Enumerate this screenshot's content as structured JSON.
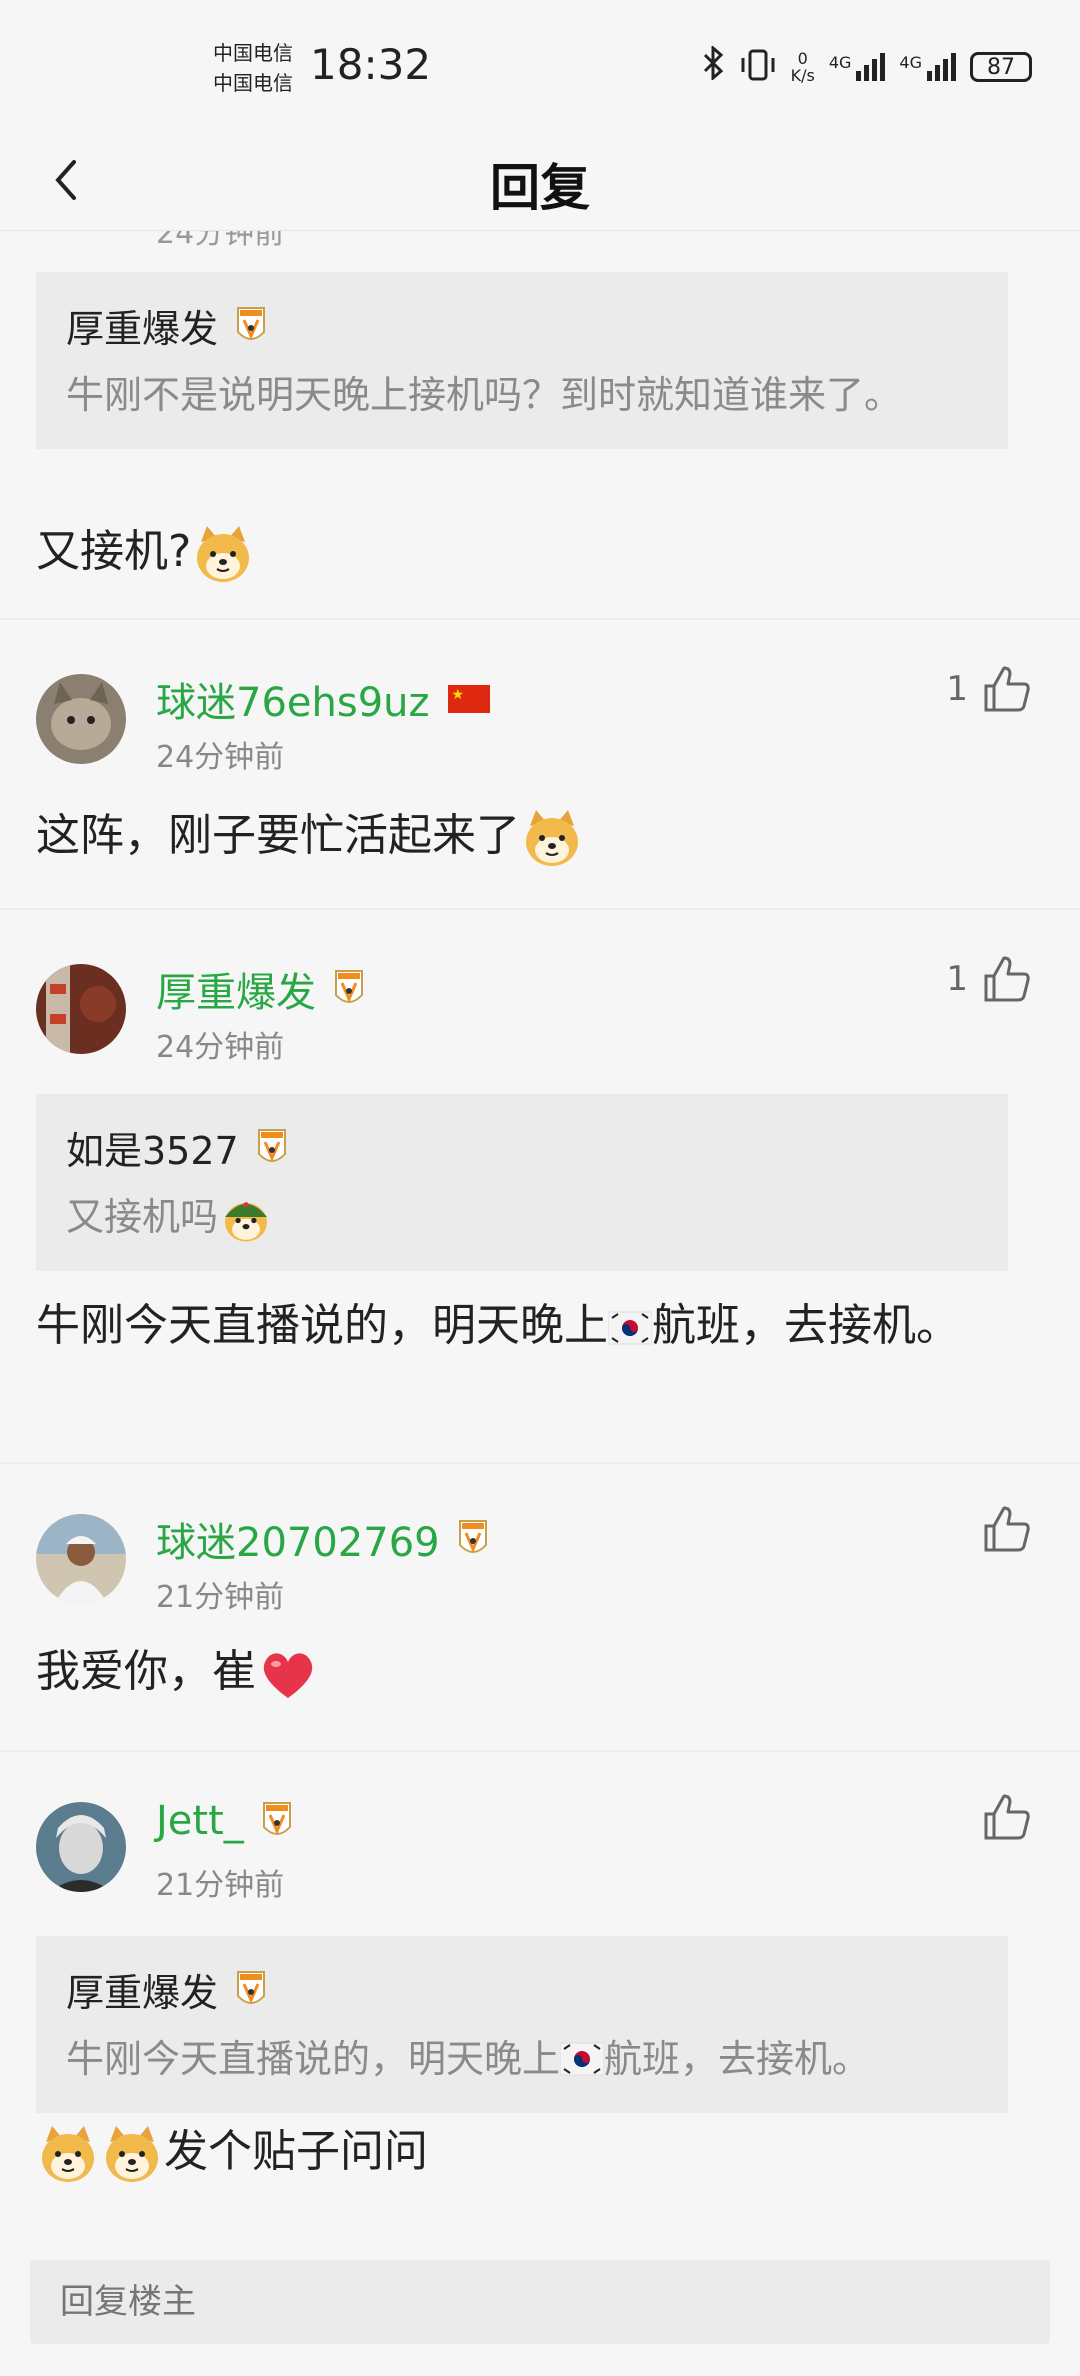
{
  "status": {
    "carrier1": "中国电信",
    "carrier2": "中国电信",
    "time": "18:32",
    "speed_value": "0",
    "speed_unit": "K/s",
    "net1": "4G",
    "net2": "4G",
    "battery": "87"
  },
  "header": {
    "title": "回复"
  },
  "partial": {
    "time": "24分钟前",
    "quote_user": "厚重爆发",
    "quote_text": "牛刚不是说明天晚上接机吗？到时就知道谁来了。",
    "text": "又接机?"
  },
  "comments": [
    {
      "user": "球迷76ehs9uz",
      "time": "24分钟前",
      "likes": "1",
      "text": "这阵，刚子要忙活起来了"
    },
    {
      "user": "厚重爆发",
      "time": "24分钟前",
      "likes": "1",
      "quote_user": "如是3527",
      "quote_text": "又接机吗",
      "text_before": "牛刚今天直播说的，明天晚上",
      "text_after": "航班，去接机。"
    },
    {
      "user": "球迷20702769",
      "time": "21分钟前",
      "likes": "",
      "text": "我爱你，崔"
    },
    {
      "user": "Jett_",
      "time": "21分钟前",
      "likes": "",
      "quote_user": "厚重爆发",
      "quote_text_before": "牛刚今天直播说的，明天晚上",
      "quote_text_after": "航班，去接机。",
      "text": "发个贴子问问"
    }
  ],
  "reply": {
    "placeholder": "回复楼主"
  },
  "colors": {
    "username": "#29a745",
    "quote_bg": "#ebebeb",
    "page_bg": "#f6f6f6"
  }
}
